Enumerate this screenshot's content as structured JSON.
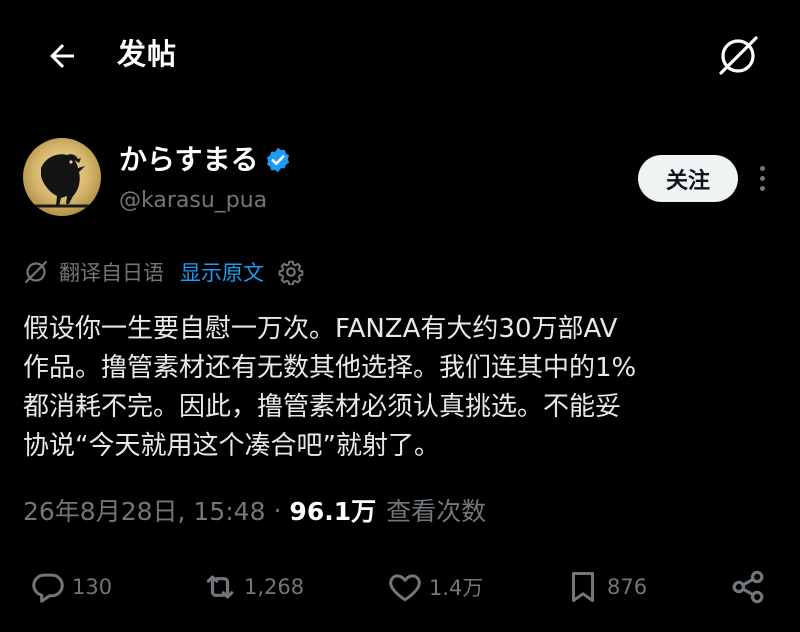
{
  "header": {
    "title": "发帖",
    "back_icon": "arrow-left-icon",
    "grok_icon": "grok-icon"
  },
  "author": {
    "display_name": "からすまる",
    "handle": "@karasu_pua",
    "verified": true,
    "verified_color": "#1d9bf0",
    "follow_label": "关注"
  },
  "translation": {
    "label": "翻译自日语",
    "show_original_label": "显示原文"
  },
  "post": {
    "lines": [
      "假设你一生要自慰一万次。FANZA有大约30万部AV",
      "作品。撸管素材还有无数其他选择。我们连其中的1%",
      "都消耗不完。因此，撸管素材必须认真挑选。不能妥",
      "协说“今天就用这个凑合吧”就射了。"
    ],
    "timestamp": "26年8月28日, 15:48",
    "dot": "·",
    "views_count": "96.1万",
    "views_label": "查看次数"
  },
  "actions": {
    "replies": "130",
    "reposts": "1,268",
    "likes": "1.4万",
    "bookmarks": "876"
  },
  "colors": {
    "background": "#000000",
    "text": "#e7e9ea",
    "muted": "#71767b",
    "accent": "#1d9bf0"
  }
}
